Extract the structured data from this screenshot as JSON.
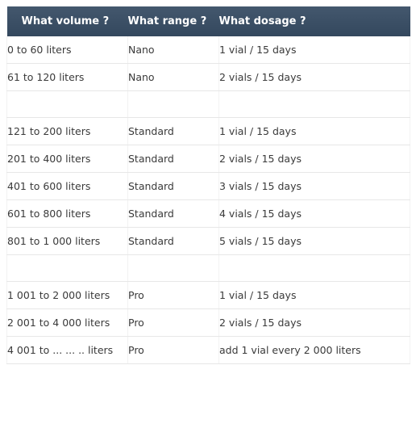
{
  "table": {
    "headers": [
      {
        "label": "What volume ?",
        "key": "volume"
      },
      {
        "label": "What range ?",
        "key": "range"
      },
      {
        "label": "What dosage ?",
        "key": "dosage"
      }
    ],
    "rows": [
      {
        "type": "data",
        "volume": "0 to 60 liters",
        "range": "Nano",
        "dosage": "1 vial / 15 days"
      },
      {
        "type": "data",
        "volume": "61 to 120 liters",
        "range": "Nano",
        "dosage": "2 vials / 15 days"
      },
      {
        "type": "spacer",
        "volume": "",
        "range": "",
        "dosage": ""
      },
      {
        "type": "data",
        "volume": "121 to 200 liters",
        "range": "Standard",
        "dosage": "1 vial / 15 days"
      },
      {
        "type": "data",
        "volume": "201 to 400 liters",
        "range": "Standard",
        "dosage": "2 vials / 15 days"
      },
      {
        "type": "data",
        "volume": "401 to 600 liters",
        "range": "Standard",
        "dosage": "3 vials / 15 days"
      },
      {
        "type": "data",
        "volume": "601 to 800 liters",
        "range": "Standard",
        "dosage": "4 vials / 15 days"
      },
      {
        "type": "wrap",
        "volume": "801 to 1 000 liters",
        "range": "Standard",
        "dosage": "5 vials / 15 days"
      },
      {
        "type": "spacer",
        "volume": "",
        "range": "",
        "dosage": ""
      },
      {
        "type": "wrap",
        "volume": "1 001 to 2 000 liters",
        "range": "Pro",
        "dosage": "1 vial / 15 days"
      },
      {
        "type": "wrap",
        "volume": "2 001 to 4 000 liters",
        "range": "Pro",
        "dosage": "2 vials / 15 days"
      },
      {
        "type": "wrap",
        "volume": "4 001 to ... ... .. liters",
        "range": "Pro",
        "dosage": "add 1 vial every 2 000 liters"
      }
    ]
  },
  "colors": {
    "header_bg_top": "#44586e",
    "header_bg_bottom": "#34485e",
    "header_text": "#ffffff",
    "body_text": "#3a3a3a",
    "row_border": "#e7e7e7",
    "page_bg": "#ffffff"
  }
}
